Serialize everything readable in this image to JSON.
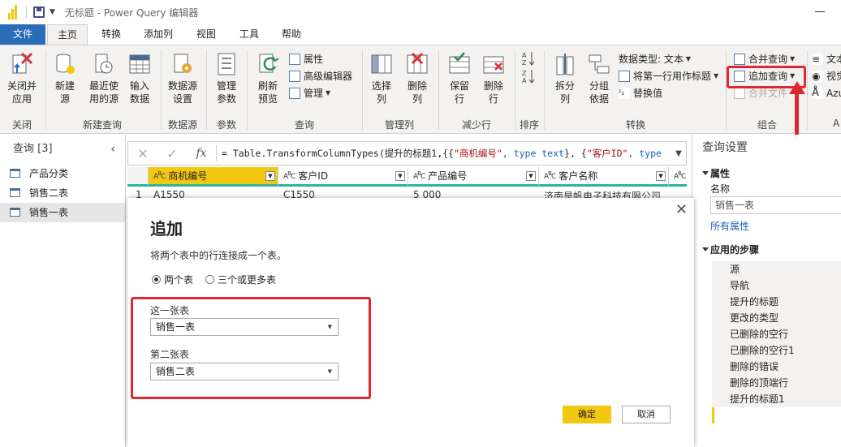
{
  "window": {
    "title": "无标题 - Power Query 编辑器"
  },
  "tabs": [
    "文件",
    "主页",
    "转换",
    "添加列",
    "视图",
    "工具",
    "帮助"
  ],
  "ribbon": {
    "close_apply": "关闭并\n应用",
    "new_source": "新建\n源",
    "recent_source": "最近使\n用的源",
    "enter_data": "输入\n数据",
    "ds_settings": "数据源\n设置",
    "manage_params": "管理\n参数",
    "refresh_preview": "刷新\n预览",
    "properties": "属性",
    "advanced_editor": "高级编辑器",
    "manage": "管理",
    "choose_cols": "选择\n列",
    "remove_cols": "删除\n列",
    "keep_rows": "保留\n行",
    "remove_rows": "删除\n行",
    "split_col": "拆分\n列",
    "group_by": "分组\n依据",
    "data_type": "数据类型: 文本",
    "first_row_header": "将第一行用作标题",
    "replace_values": "替换值",
    "merge_queries": "合并查询",
    "append_queries": "追加查询",
    "combine_files": "合并文件",
    "text_ai": "文本",
    "vision": "视觉",
    "azure": "Azu",
    "groups": {
      "close": "关闭",
      "new_query": "新建查询",
      "data_source": "数据源",
      "params": "参数",
      "query": "查询",
      "manage_cols": "管理列",
      "reduce_rows": "减少行",
      "sort": "排序",
      "transform": "转换",
      "combine": "组合",
      "ai": "A"
    }
  },
  "queries": {
    "header": "查询 [3]",
    "items": [
      "产品分类",
      "销售二表",
      "销售一表"
    ],
    "selected_index": 2
  },
  "formula": {
    "prefix": "= Table.TransformColumnTypes(提升的标题1,{{",
    "s1": "\"商机编号\"",
    "k1": ", type text",
    "mid": "}, {",
    "s2": "\"客户ID\"",
    "k2": ", type"
  },
  "grid": {
    "columns": [
      "商机编号",
      "客户ID",
      "产品编号",
      "客户名称"
    ],
    "row1": [
      "1",
      "A1550",
      "C1550",
      "5 000",
      "济南是帆电子科技有限公司"
    ]
  },
  "settings": {
    "title": "查询设置",
    "properties_label": "属性",
    "name_label": "名称",
    "name_value": "销售一表",
    "all_properties": "所有属性",
    "steps_label": "应用的步骤",
    "steps": [
      "源",
      "导航",
      "提升的标题",
      "更改的类型",
      "已删除的空行",
      "已删除的空行1",
      "删除的错误",
      "删除的顶端行",
      "提升的标题1",
      ""
    ]
  },
  "dialog": {
    "title": "追加",
    "description": "将两个表中的行连接成一个表。",
    "option_two": "两个表",
    "option_three": "三个或更多表",
    "first_label": "这一张表",
    "first_value": "销售一表",
    "second_label": "第二张表",
    "second_value": "销售二表",
    "ok": "确定",
    "cancel": "取消"
  }
}
